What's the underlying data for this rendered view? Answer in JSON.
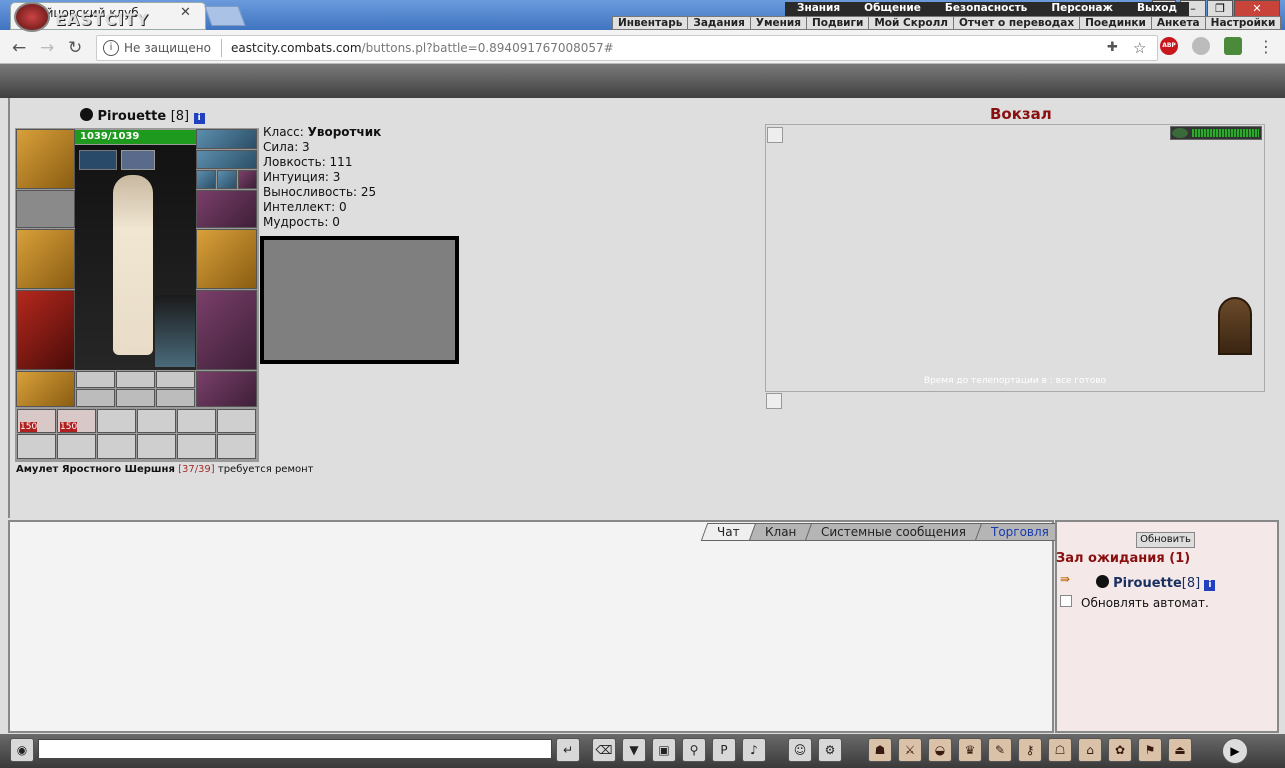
{
  "browser": {
    "tab_title": "Бойцовский клуб",
    "tab_close": "✕",
    "security_text": "Не защищено",
    "url_host": "eastcity.combats.com",
    "url_path": "/buttons.pl?battle=0.894091767008057#"
  },
  "game_header": {
    "logo_text": "EASTCITY",
    "menu_top": [
      "Знания",
      "Общение",
      "Безопасность",
      "Персонаж",
      "Выход"
    ],
    "menu_bottom": [
      "Инвентарь",
      "Задания",
      "Умения",
      "Подвиги",
      "Мой Скролл",
      "Отчет о переводах",
      "Поединки",
      "Анкета",
      "Настройки"
    ]
  },
  "character": {
    "name": "Pirouette",
    "level": "[8]",
    "hp": "1039/1039",
    "stats": {
      "class_label": "Класс:",
      "class_value": "Уворотчик",
      "strength": "Сила: 3",
      "agility": "Ловкость: 111",
      "intuition": "Интуиция: 3",
      "endurance": "Выносливость: 25",
      "intellect": "Интеллект: 0",
      "wisdom": "Мудрость: 0"
    },
    "amulet": {
      "name": "Амулет Яростного Шершня",
      "durability": "[37/39]",
      "note": "требуется ремонт"
    },
    "potion_counts": [
      "150",
      "150"
    ]
  },
  "location": {
    "title": "Вокзал",
    "teleport_text": "Время до телепортации в : все готово"
  },
  "chat": {
    "tabs": [
      "Чат",
      "Клан",
      "Системные сообщения",
      "Торговля"
    ]
  },
  "side_panel": {
    "refresh_label": "Обновить",
    "hall_title": "Зал ожидания (1)",
    "member_name": "Pirouette",
    "member_level": "[8]",
    "auto_refresh_label": "Обновлять автомат."
  }
}
